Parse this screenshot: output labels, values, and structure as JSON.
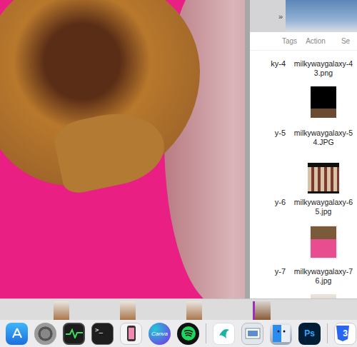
{
  "finder": {
    "toolbar_button": "»",
    "columns": [
      "Tags",
      "Action",
      "Se"
    ],
    "rows": [
      {
        "prefix": "ky-4",
        "name_lines": [
          "milkywaygalaxy-4",
          "3.png"
        ]
      },
      {
        "prefix": "y-5",
        "name_lines": [
          "milkywaygalaxy-5",
          "4.JPG"
        ]
      },
      {
        "prefix": "y-6",
        "name_lines": [
          "milkywaygalaxy-6",
          "5.jpg"
        ]
      },
      {
        "prefix": "y-7",
        "name_lines": [
          "milkywaygalaxy-7",
          "6.jpg"
        ]
      }
    ]
  },
  "dock": [
    {
      "kind": "appstore",
      "label": ""
    },
    {
      "kind": "settings",
      "label": ""
    },
    {
      "kind": "activity",
      "label": ""
    },
    {
      "kind": "terminal",
      "label": ">_"
    },
    {
      "kind": "phone",
      "label": ""
    },
    {
      "kind": "canva",
      "label": "Canva"
    },
    {
      "kind": "spotify",
      "label": ""
    },
    {
      "kind": "separator",
      "label": ""
    },
    {
      "kind": "surfshark",
      "label": ""
    },
    {
      "kind": "preview",
      "label": ""
    },
    {
      "kind": "finder",
      "label": ""
    },
    {
      "kind": "photoshop",
      "label": "Ps"
    },
    {
      "kind": "separator",
      "label": ""
    },
    {
      "kind": "css",
      "label": "3"
    }
  ]
}
